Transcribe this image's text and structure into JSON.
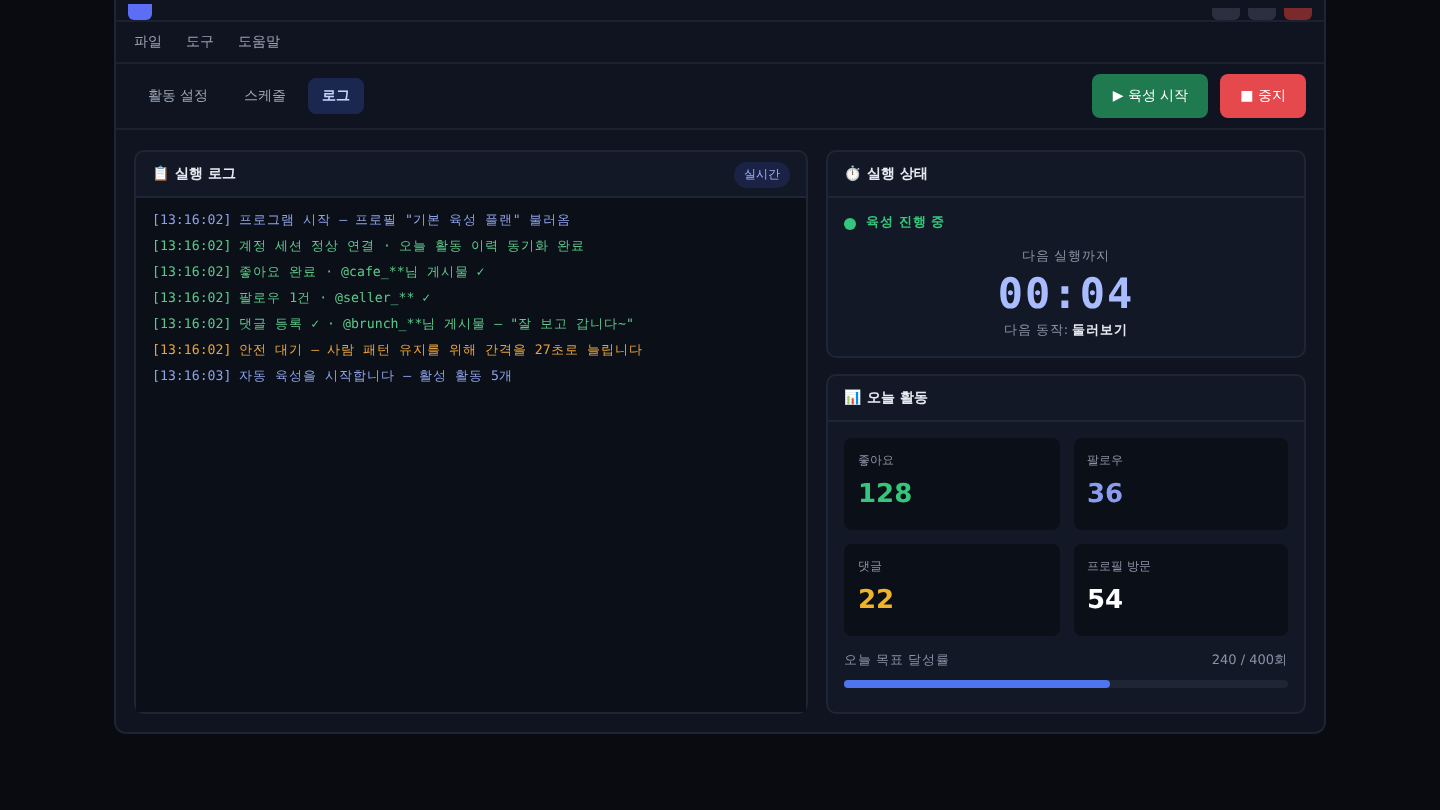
{
  "menu": [
    "파일",
    "도구",
    "도움말"
  ],
  "tabs": [
    {
      "label": "활동 설정",
      "selected": false
    },
    {
      "label": "스케줄",
      "selected": false
    },
    {
      "label": "로그",
      "selected": true
    }
  ],
  "actions": [
    {
      "kind": "start",
      "label": "▶ 육성 시작"
    },
    {
      "kind": "stop",
      "label": "■ 중지"
    }
  ],
  "log": {
    "title": "📋 실행 로그",
    "badge": "실시간",
    "lines": [
      {
        "kind": "info",
        "text": "[13:16:02] 프로그램 시작 — 프로필 \"기본 육성 플랜\" 불러옴"
      },
      {
        "kind": "success",
        "text": "[13:16:02] 계정 세션 정상 연결 · 오늘 활동 이력 동기화 완료"
      },
      {
        "kind": "success",
        "text": "[13:16:02] 좋아요 완료 · @cafe_**님 게시물 ✓"
      },
      {
        "kind": "success",
        "text": "[13:16:02] 팔로우 1건 · @seller_** ✓"
      },
      {
        "kind": "success",
        "text": "[13:16:02] 댓글 등록 ✓ · @brunch_**님 게시물 — \"잘 보고 갑니다~\""
      },
      {
        "kind": "warning",
        "text": "[13:16:02] 안전 대기 — 사람 패턴 유지를 위해 간격을 27초로 늘립니다"
      },
      {
        "kind": "info",
        "text": "[13:16:03] 자동 육성을 시작합니다 — 활성 활동 5개"
      }
    ]
  },
  "status": {
    "title": "⏱️ 실행 상태",
    "state": "육성 진행 중",
    "running": true,
    "next_label": "다음 실행까지",
    "countdown": "00:04",
    "next_action_label": "다음 동작:",
    "next_action": "둘러보기"
  },
  "today": {
    "title": "📊 오늘 활동",
    "stats": [
      {
        "label": "좋아요",
        "value": "128",
        "color": "#34c77b"
      },
      {
        "label": "팔로우",
        "value": "36",
        "color": "#8b9cf0"
      },
      {
        "label": "댓글",
        "value": "22",
        "color": "#f0b429"
      },
      {
        "label": "프로필 방문",
        "value": "54",
        "color": "#ffffff"
      }
    ],
    "goal_label": "오늘 목표 달성률",
    "goal_value": "240 / 400회",
    "level": 0.6
  }
}
